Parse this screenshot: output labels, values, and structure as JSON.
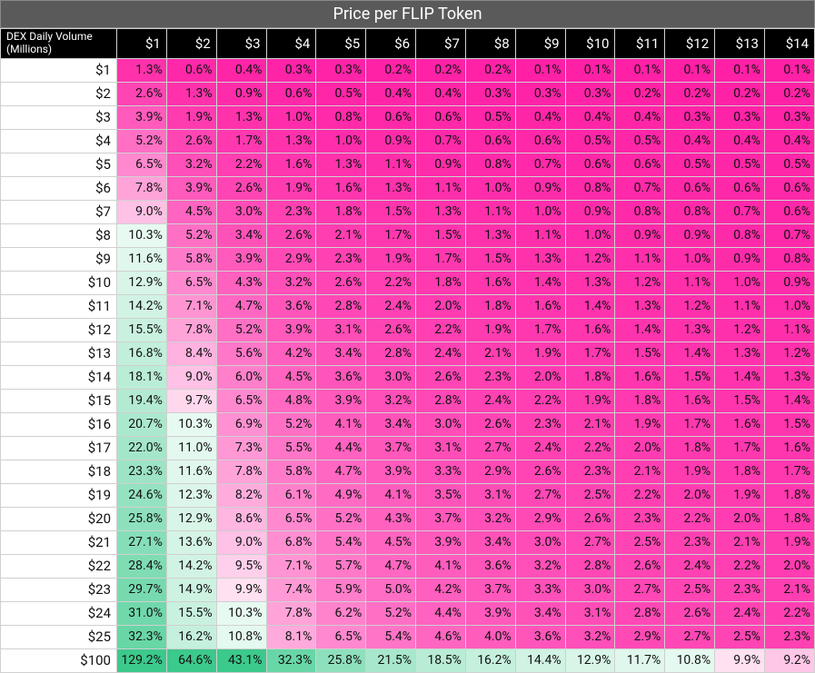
{
  "title": "Price per FLIP Token",
  "corner_label": "DEX Daily Volume (Millions)",
  "col_labels": [
    "$1",
    "$2",
    "$3",
    "$4",
    "$5",
    "$6",
    "$7",
    "$8",
    "$9",
    "$10",
    "$11",
    "$12",
    "$13",
    "$14"
  ],
  "row_labels": [
    "$1",
    "$2",
    "$3",
    "$4",
    "$5",
    "$6",
    "$7",
    "$8",
    "$9",
    "$10",
    "$11",
    "$12",
    "$13",
    "$14",
    "$15",
    "$16",
    "$17",
    "$18",
    "$19",
    "$20",
    "$21",
    "$22",
    "$23",
    "$24",
    "$25",
    "$100"
  ],
  "chart_data": {
    "type": "heatmap",
    "title": "Price per FLIP Token",
    "xlabel": "Price per FLIP Token ($)",
    "ylabel": "DEX Daily Volume (Millions $)",
    "x": [
      1,
      2,
      3,
      4,
      5,
      6,
      7,
      8,
      9,
      10,
      11,
      12,
      13,
      14
    ],
    "y": [
      1,
      2,
      3,
      4,
      5,
      6,
      7,
      8,
      9,
      10,
      11,
      12,
      13,
      14,
      15,
      16,
      17,
      18,
      19,
      20,
      21,
      22,
      23,
      24,
      25,
      100
    ],
    "values_pct": [
      [
        1.3,
        0.6,
        0.4,
        0.3,
        0.3,
        0.2,
        0.2,
        0.2,
        0.1,
        0.1,
        0.1,
        0.1,
        0.1,
        0.1
      ],
      [
        2.6,
        1.3,
        0.9,
        0.6,
        0.5,
        0.4,
        0.4,
        0.3,
        0.3,
        0.3,
        0.2,
        0.2,
        0.2,
        0.2
      ],
      [
        3.9,
        1.9,
        1.3,
        1.0,
        0.8,
        0.6,
        0.6,
        0.5,
        0.4,
        0.4,
        0.4,
        0.3,
        0.3,
        0.3
      ],
      [
        5.2,
        2.6,
        1.7,
        1.3,
        1.0,
        0.9,
        0.7,
        0.6,
        0.6,
        0.5,
        0.5,
        0.4,
        0.4,
        0.4
      ],
      [
        6.5,
        3.2,
        2.2,
        1.6,
        1.3,
        1.1,
        0.9,
        0.8,
        0.7,
        0.6,
        0.6,
        0.5,
        0.5,
        0.5
      ],
      [
        7.8,
        3.9,
        2.6,
        1.9,
        1.6,
        1.3,
        1.1,
        1.0,
        0.9,
        0.8,
        0.7,
        0.6,
        0.6,
        0.6
      ],
      [
        9.0,
        4.5,
        3.0,
        2.3,
        1.8,
        1.5,
        1.3,
        1.1,
        1.0,
        0.9,
        0.8,
        0.8,
        0.7,
        0.6
      ],
      [
        10.3,
        5.2,
        3.4,
        2.6,
        2.1,
        1.7,
        1.5,
        1.3,
        1.1,
        1.0,
        0.9,
        0.9,
        0.8,
        0.7
      ],
      [
        11.6,
        5.8,
        3.9,
        2.9,
        2.3,
        1.9,
        1.7,
        1.5,
        1.3,
        1.2,
        1.1,
        1.0,
        0.9,
        0.8
      ],
      [
        12.9,
        6.5,
        4.3,
        3.2,
        2.6,
        2.2,
        1.8,
        1.6,
        1.4,
        1.3,
        1.2,
        1.1,
        1.0,
        0.9
      ],
      [
        14.2,
        7.1,
        4.7,
        3.6,
        2.8,
        2.4,
        2.0,
        1.8,
        1.6,
        1.4,
        1.3,
        1.2,
        1.1,
        1.0
      ],
      [
        15.5,
        7.8,
        5.2,
        3.9,
        3.1,
        2.6,
        2.2,
        1.9,
        1.7,
        1.6,
        1.4,
        1.3,
        1.2,
        1.1
      ],
      [
        16.8,
        8.4,
        5.6,
        4.2,
        3.4,
        2.8,
        2.4,
        2.1,
        1.9,
        1.7,
        1.5,
        1.4,
        1.3,
        1.2
      ],
      [
        18.1,
        9.0,
        6.0,
        4.5,
        3.6,
        3.0,
        2.6,
        2.3,
        2.0,
        1.8,
        1.6,
        1.5,
        1.4,
        1.3
      ],
      [
        19.4,
        9.7,
        6.5,
        4.8,
        3.9,
        3.2,
        2.8,
        2.4,
        2.2,
        1.9,
        1.8,
        1.6,
        1.5,
        1.4
      ],
      [
        20.7,
        10.3,
        6.9,
        5.2,
        4.1,
        3.4,
        3.0,
        2.6,
        2.3,
        2.1,
        1.9,
        1.7,
        1.6,
        1.5
      ],
      [
        22.0,
        11.0,
        7.3,
        5.5,
        4.4,
        3.7,
        3.1,
        2.7,
        2.4,
        2.2,
        2.0,
        1.8,
        1.7,
        1.6
      ],
      [
        23.3,
        11.6,
        7.8,
        5.8,
        4.7,
        3.9,
        3.3,
        2.9,
        2.6,
        2.3,
        2.1,
        1.9,
        1.8,
        1.7
      ],
      [
        24.6,
        12.3,
        8.2,
        6.1,
        4.9,
        4.1,
        3.5,
        3.1,
        2.7,
        2.5,
        2.2,
        2.0,
        1.9,
        1.8
      ],
      [
        25.8,
        12.9,
        8.6,
        6.5,
        5.2,
        4.3,
        3.7,
        3.2,
        2.9,
        2.6,
        2.3,
        2.2,
        2.0,
        1.8
      ],
      [
        27.1,
        13.6,
        9.0,
        6.8,
        5.4,
        4.5,
        3.9,
        3.4,
        3.0,
        2.7,
        2.5,
        2.3,
        2.1,
        1.9
      ],
      [
        28.4,
        14.2,
        9.5,
        7.1,
        5.7,
        4.7,
        4.1,
        3.6,
        3.2,
        2.8,
        2.6,
        2.4,
        2.2,
        2.0
      ],
      [
        29.7,
        14.9,
        9.9,
        7.4,
        5.9,
        5.0,
        4.2,
        3.7,
        3.3,
        3.0,
        2.7,
        2.5,
        2.3,
        2.1
      ],
      [
        31.0,
        15.5,
        10.3,
        7.8,
        6.2,
        5.2,
        4.4,
        3.9,
        3.4,
        3.1,
        2.8,
        2.6,
        2.4,
        2.2
      ],
      [
        32.3,
        16.2,
        10.8,
        8.1,
        6.5,
        5.4,
        4.6,
        4.0,
        3.6,
        3.2,
        2.9,
        2.7,
        2.5,
        2.3
      ],
      [
        129.2,
        64.6,
        43.1,
        32.3,
        25.8,
        21.5,
        18.5,
        16.2,
        14.4,
        12.9,
        11.7,
        10.8,
        9.9,
        9.2
      ]
    ]
  },
  "colors": {
    "green_dark": "#3cc98c",
    "green_light": "#e9faf2",
    "pink_dark": "#ff1fa5",
    "pink_light": "#ffe9f5",
    "neutral": "#ffffff"
  }
}
